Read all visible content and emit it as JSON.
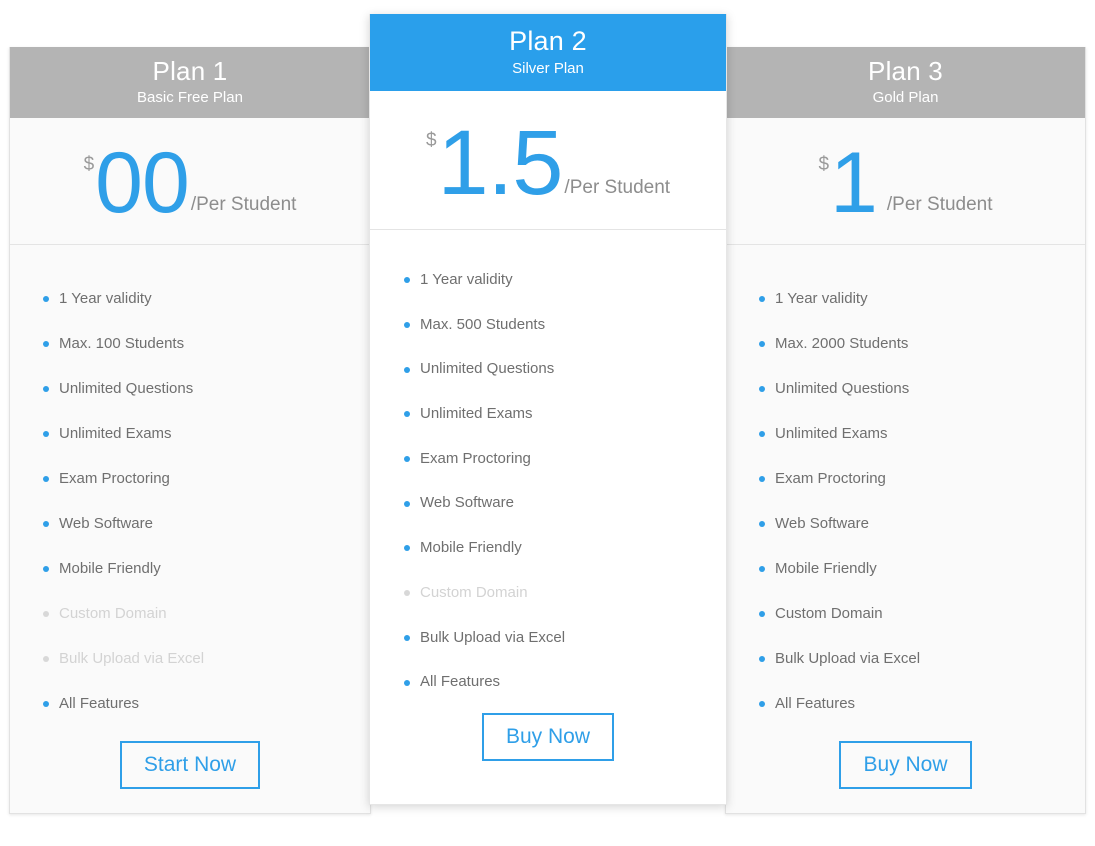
{
  "theme": {
    "accent": "#2f9fe8",
    "featured_header_bg": "#2a9feb",
    "plain_header_bg": "#b4b4b4",
    "text": "#6f6f6f",
    "disabled_text": "#d3d3d3",
    "card_bg": "#fafafa",
    "featured_card_bg": "#ffffff"
  },
  "plans": [
    {
      "id": "plan-1",
      "featured": false,
      "title": "Plan 1",
      "subtitle": "Basic Free Plan",
      "currency": "$",
      "amount": "00",
      "per": "/Per Student",
      "cta_label": "Start Now",
      "features": [
        {
          "label": "1 Year validity",
          "enabled": true
        },
        {
          "label": "Max. 100 Students",
          "enabled": true
        },
        {
          "label": "Unlimited Questions",
          "enabled": true
        },
        {
          "label": "Unlimited Exams",
          "enabled": true
        },
        {
          "label": "Exam Proctoring",
          "enabled": true
        },
        {
          "label": "Web Software",
          "enabled": true
        },
        {
          "label": "Mobile Friendly",
          "enabled": true
        },
        {
          "label": "Custom Domain",
          "enabled": false
        },
        {
          "label": "Bulk Upload via Excel",
          "enabled": false
        },
        {
          "label": "All Features",
          "enabled": true
        }
      ]
    },
    {
      "id": "plan-2",
      "featured": true,
      "title": "Plan 2",
      "subtitle": "Silver Plan",
      "currency": "$",
      "amount": "1.5",
      "per": "/Per Student",
      "cta_label": "Buy Now",
      "features": [
        {
          "label": "1 Year validity",
          "enabled": true
        },
        {
          "label": "Max. 500 Students",
          "enabled": true
        },
        {
          "label": "Unlimited Questions",
          "enabled": true
        },
        {
          "label": "Unlimited Exams",
          "enabled": true
        },
        {
          "label": "Exam Proctoring",
          "enabled": true
        },
        {
          "label": "Web Software",
          "enabled": true
        },
        {
          "label": "Mobile Friendly",
          "enabled": true
        },
        {
          "label": "Custom Domain",
          "enabled": false
        },
        {
          "label": "Bulk Upload via Excel",
          "enabled": true
        },
        {
          "label": "All Features",
          "enabled": true
        }
      ]
    },
    {
      "id": "plan-3",
      "featured": false,
      "title": "Plan 3",
      "subtitle": "Gold Plan",
      "currency": "$",
      "amount": "1",
      "per": "/Per Student",
      "cta_label": "Buy Now",
      "features": [
        {
          "label": "1 Year validity",
          "enabled": true
        },
        {
          "label": "Max. 2000 Students",
          "enabled": true
        },
        {
          "label": "Unlimited Questions",
          "enabled": true
        },
        {
          "label": "Unlimited Exams",
          "enabled": true
        },
        {
          "label": "Exam Proctoring",
          "enabled": true
        },
        {
          "label": "Web Software",
          "enabled": true
        },
        {
          "label": "Mobile Friendly",
          "enabled": true
        },
        {
          "label": "Custom Domain",
          "enabled": true
        },
        {
          "label": "Bulk Upload via Excel",
          "enabled": true
        },
        {
          "label": "All Features",
          "enabled": true
        }
      ]
    }
  ]
}
